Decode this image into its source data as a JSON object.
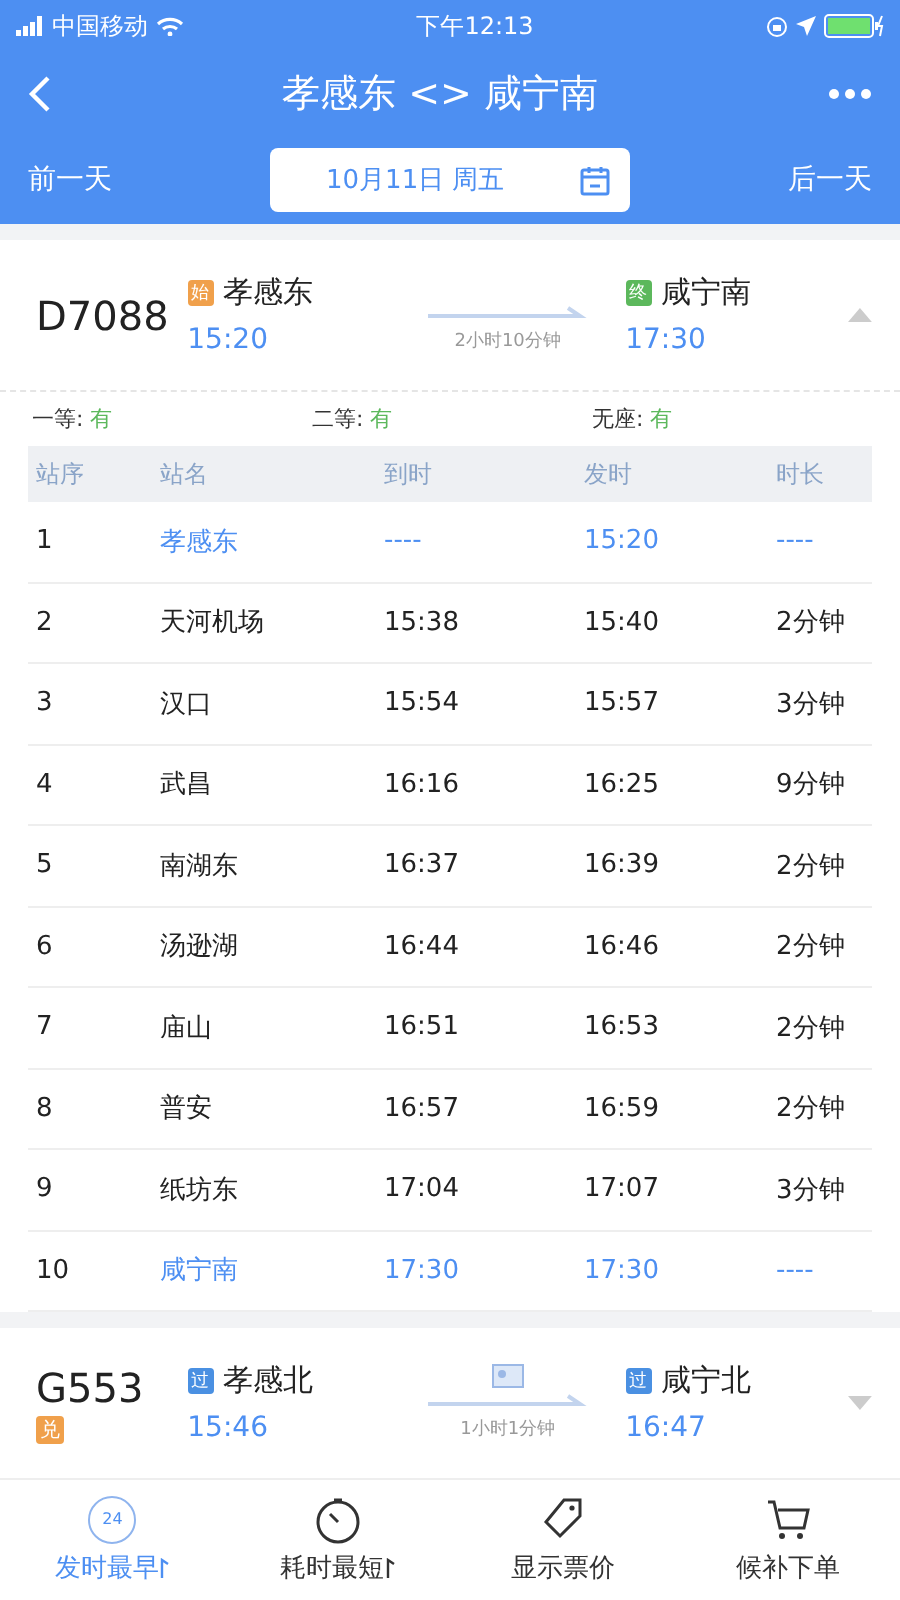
{
  "status_bar": {
    "carrier": "中国移动",
    "time": "下午12:13"
  },
  "nav": {
    "title": "孝感东 <> 咸宁南"
  },
  "date_bar": {
    "prev": "前一天",
    "date": "10月11日 周五",
    "next": "后一天"
  },
  "trains": [
    {
      "number": "D7088",
      "expanded": true,
      "from": {
        "badge": "始",
        "color": "#f0a04b",
        "station": "孝感东",
        "time": "15:20"
      },
      "duration": "2小时10分钟",
      "to": {
        "badge": "终",
        "color": "#5cb85c",
        "station": "咸宁南",
        "time": "17:30"
      },
      "seats": [
        {
          "label": "一等:",
          "value": "有"
        },
        {
          "label": "二等:",
          "value": "有"
        },
        {
          "label": "无座:",
          "value": "有"
        }
      ],
      "columns": [
        "站序",
        "站名",
        "到时",
        "发时",
        "时长"
      ],
      "stops": [
        {
          "no": "1",
          "name": "孝感东",
          "arrive": "----",
          "depart": "15:20",
          "stay": "----",
          "highlighted": true
        },
        {
          "no": "2",
          "name": "天河机场",
          "arrive": "15:38",
          "depart": "15:40",
          "stay": "2分钟",
          "highlighted": false
        },
        {
          "no": "3",
          "name": "汉口",
          "arrive": "15:54",
          "depart": "15:57",
          "stay": "3分钟",
          "highlighted": false
        },
        {
          "no": "4",
          "name": "武昌",
          "arrive": "16:16",
          "depart": "16:25",
          "stay": "9分钟",
          "highlighted": false
        },
        {
          "no": "5",
          "name": "南湖东",
          "arrive": "16:37",
          "depart": "16:39",
          "stay": "2分钟",
          "highlighted": false
        },
        {
          "no": "6",
          "name": "汤逊湖",
          "arrive": "16:44",
          "depart": "16:46",
          "stay": "2分钟",
          "highlighted": false
        },
        {
          "no": "7",
          "name": "庙山",
          "arrive": "16:51",
          "depart": "16:53",
          "stay": "2分钟",
          "highlighted": false
        },
        {
          "no": "8",
          "name": "普安",
          "arrive": "16:57",
          "depart": "16:59",
          "stay": "2分钟",
          "highlighted": false
        },
        {
          "no": "9",
          "name": "纸坊东",
          "arrive": "17:04",
          "depart": "17:07",
          "stay": "3分钟",
          "highlighted": false
        },
        {
          "no": "10",
          "name": "咸宁南",
          "arrive": "17:30",
          "depart": "17:30",
          "stay": "----",
          "highlighted": true
        }
      ]
    },
    {
      "number": "G553",
      "tag": "兑",
      "expanded": false,
      "from": {
        "badge": "过",
        "color": "#4a90e2",
        "station": "孝感北",
        "time": "15:46"
      },
      "duration": "1小时1分钟",
      "to": {
        "badge": "过",
        "color": "#4a90e2",
        "station": "咸宁北",
        "time": "16:47"
      }
    }
  ],
  "bottom_bar": [
    {
      "kind": "clock24",
      "label": "发时最早",
      "icon_text": "24",
      "selected": true
    },
    {
      "kind": "timer",
      "label": "耗时最短",
      "selected": false
    },
    {
      "kind": "tag",
      "label": "显示票价",
      "selected": false
    },
    {
      "kind": "cart",
      "label": "候补下单",
      "selected": false
    }
  ]
}
